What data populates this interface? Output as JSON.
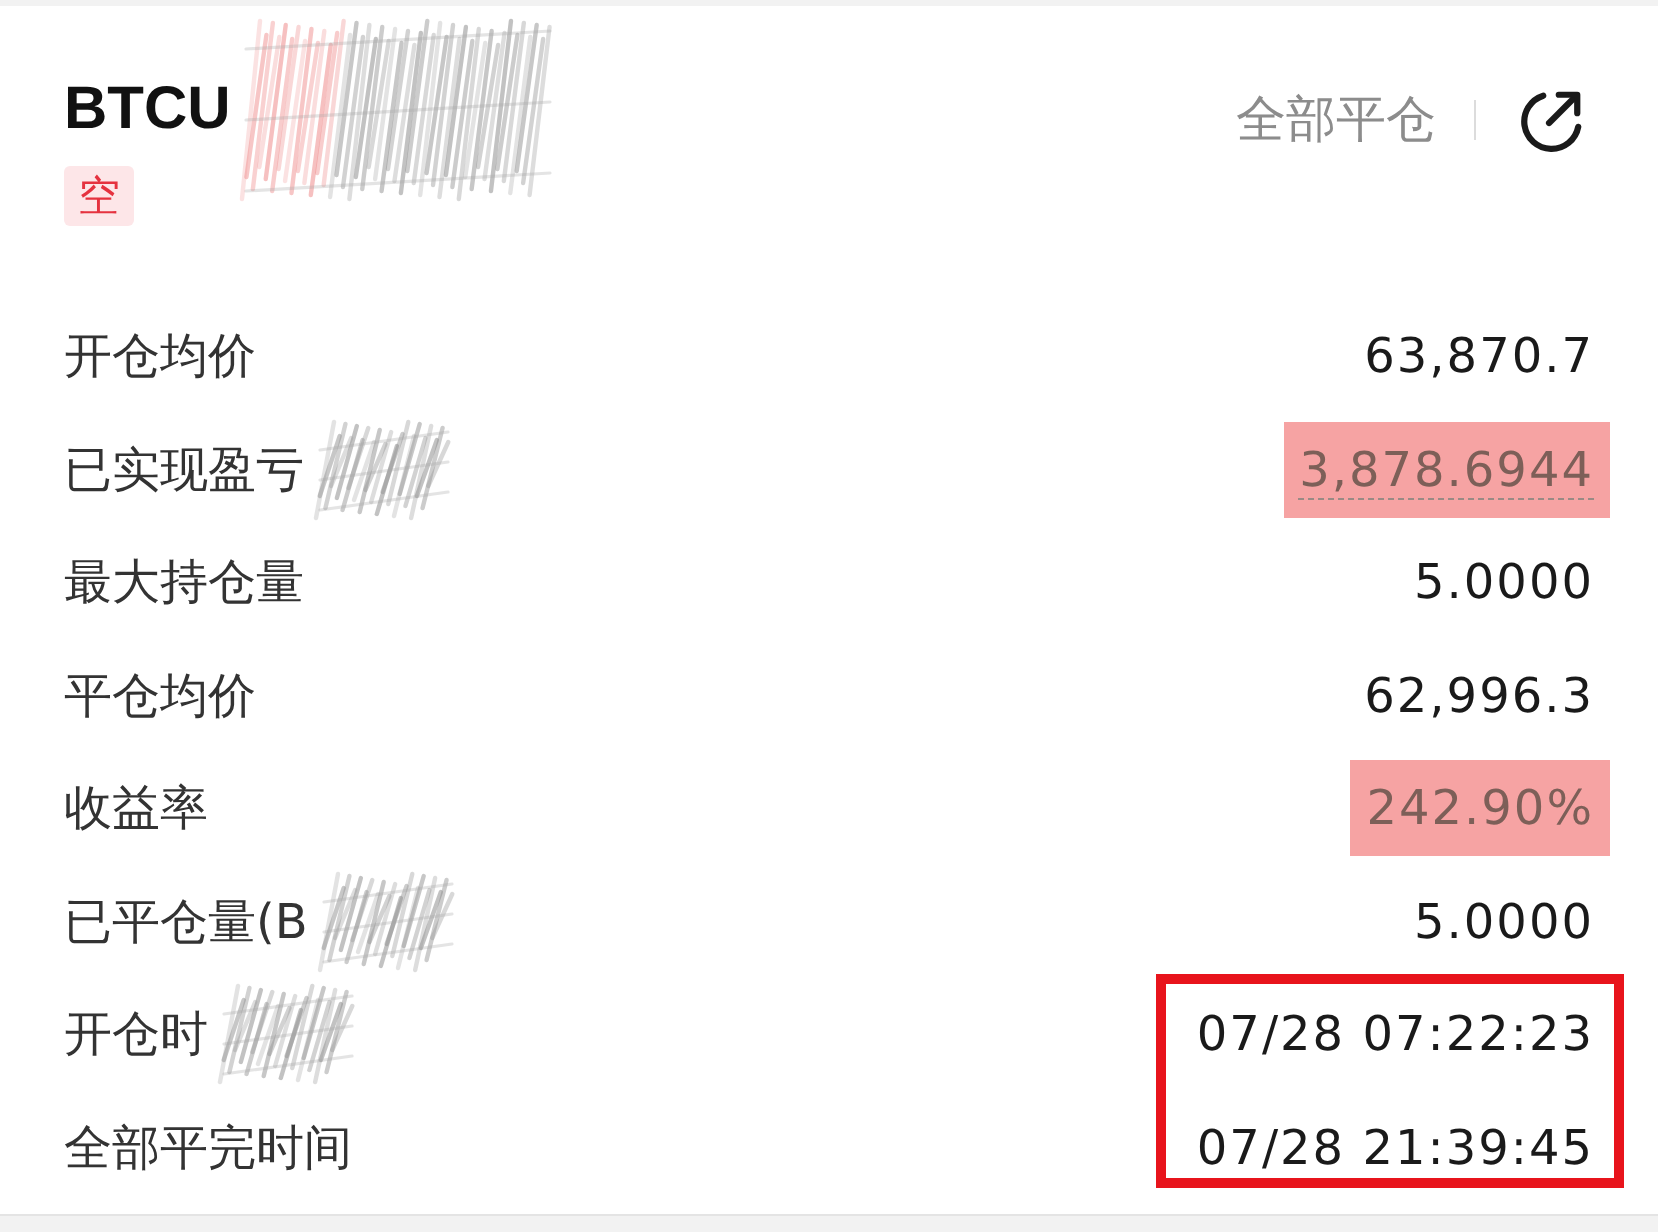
{
  "header": {
    "title": "BTCU",
    "title_scribbled": true,
    "side_tag": {
      "kind": "short",
      "label": "空"
    },
    "close_all": "全部平仓"
  },
  "rows": [
    {
      "label": "开仓均价",
      "label_scribbled": false,
      "value": "63,870.7",
      "highlighted": false,
      "underlined": false,
      "boxed": false
    },
    {
      "label": "已实现盈亏",
      "label_scribbled": true,
      "value": "3,878.6944",
      "highlighted": true,
      "underlined": true,
      "boxed": false
    },
    {
      "label": "最大持仓量",
      "label_scribbled": false,
      "value": "5.0000",
      "highlighted": false,
      "underlined": false,
      "boxed": false
    },
    {
      "label": "平仓均价",
      "label_scribbled": false,
      "value": "62,996.3",
      "highlighted": false,
      "underlined": false,
      "boxed": false
    },
    {
      "label": "收益率",
      "label_scribbled": false,
      "value": "242.90%",
      "highlighted": true,
      "underlined": false,
      "boxed": false
    },
    {
      "label": "已平仓量(B",
      "label_scribbled": true,
      "value": "5.0000",
      "highlighted": false,
      "underlined": false,
      "boxed": false
    },
    {
      "label": "开仓时",
      "label_scribbled": true,
      "value": "07/28 07:22:23",
      "highlighted": false,
      "underlined": false,
      "boxed": true
    },
    {
      "label": "全部平完时间",
      "label_scribbled": false,
      "value": "07/28 21:39:45",
      "highlighted": false,
      "underlined": false,
      "boxed": true
    }
  ]
}
